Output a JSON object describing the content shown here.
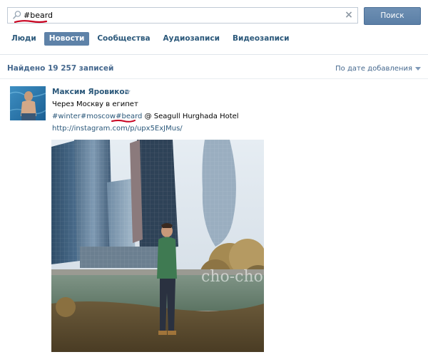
{
  "search": {
    "value": "#beard",
    "button_label": "Поиск",
    "clear_icon": "×"
  },
  "tabs": [
    {
      "label": "Люди",
      "active": false
    },
    {
      "label": "Новости",
      "active": true
    },
    {
      "label": "Сообщества",
      "active": false
    },
    {
      "label": "Аудиозаписи",
      "active": false
    },
    {
      "label": "Видеозаписи",
      "active": false
    }
  ],
  "results": {
    "summary": "Найдено 19 257 записей",
    "sort_label": "По дате добавления"
  },
  "post": {
    "author": "Максим Яровиков",
    "text_line": "Через Москву в египет",
    "tags_part1": "#winter#moscow",
    "tags_part2": "#beard",
    "tags_part3": " @ Seagull Hurghada Hotel",
    "link": "http://instagram.com/p/upx5ExJMus/"
  },
  "watermark": "cho-cho.ru",
  "colors": {
    "link": "#2b587a",
    "accent": "#5e82a8",
    "underline_mark": "#c8001e"
  }
}
